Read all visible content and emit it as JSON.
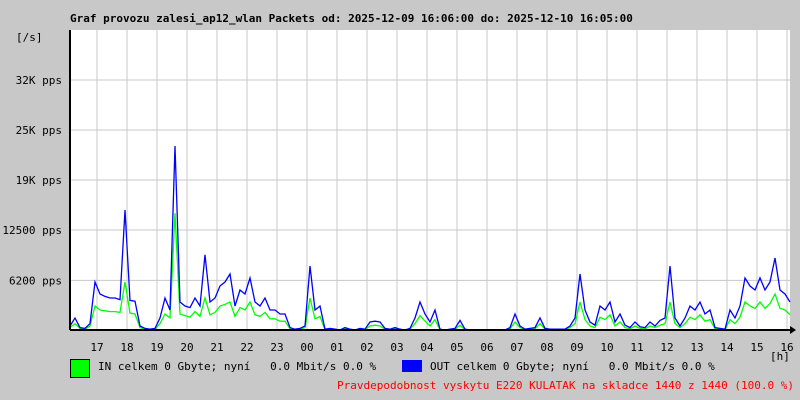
{
  "chart_data": {
    "type": "line",
    "title": "Graf provozu zalesi_ap12_wlan Packets od: 2025-12-09 16:06:00 do: 2025-12-10 16:05:00",
    "ylabel": "[/s]",
    "xlabel": "[h]",
    "ylim": [
      0,
      37500
    ],
    "xlim_hours": [
      0,
      24
    ],
    "grid": true,
    "y_ticks": [
      {
        "value": 6200,
        "label": "6200 pps"
      },
      {
        "value": 12500,
        "label": "12500 pps"
      },
      {
        "value": 18750,
        "label": "19K pps"
      },
      {
        "value": 25000,
        "label": "25K pps"
      },
      {
        "value": 31250,
        "label": "32K pps"
      }
    ],
    "x_tick_labels": [
      "17",
      "18",
      "19",
      "20",
      "21",
      "22",
      "23",
      "00",
      "01",
      "02",
      "03",
      "04",
      "05",
      "06",
      "07",
      "08",
      "09",
      "10",
      "11",
      "12",
      "13",
      "14",
      "15",
      "16"
    ],
    "x_first_tick_offset_hours": 0.9,
    "sample_interval_minutes": 10,
    "series": [
      {
        "name": "IN",
        "color": "#00ff00",
        "values": [
          300,
          800,
          200,
          100,
          500,
          3000,
          2500,
          2400,
          2300,
          2300,
          2200,
          6000,
          2100,
          2000,
          300,
          100,
          50,
          100,
          800,
          2000,
          1500,
          14600,
          2000,
          1800,
          1600,
          2300,
          1700,
          4000,
          1900,
          2200,
          3000,
          3200,
          3500,
          1700,
          2800,
          2500,
          3500,
          1900,
          1700,
          2200,
          1400,
          1400,
          1100,
          1100,
          150,
          50,
          100,
          300,
          4000,
          1400,
          1700,
          50,
          100,
          50,
          0,
          150,
          50,
          0,
          100,
          50,
          500,
          600,
          500,
          100,
          50,
          150,
          50,
          0,
          100,
          800,
          1800,
          1100,
          500,
          1300,
          50,
          0,
          50,
          100,
          600,
          50,
          0,
          0,
          0,
          0,
          0,
          0,
          0,
          0,
          150,
          1000,
          300,
          50,
          100,
          150,
          800,
          100,
          50,
          50,
          50,
          50,
          300,
          800,
          3500,
          1300,
          500,
          300,
          1600,
          1300,
          1900,
          500,
          1000,
          300,
          150,
          500,
          200,
          150,
          500,
          300,
          600,
          800,
          3500,
          800,
          300,
          800,
          1600,
          1300,
          1900,
          1100,
          1300,
          150,
          100,
          50,
          1300,
          800,
          1600,
          3500,
          3000,
          2700,
          3500,
          2700,
          3300,
          4500,
          2700,
          2500,
          1900
        ]
      },
      {
        "name": "OUT",
        "color": "#0000ff",
        "values": [
          500,
          1500,
          300,
          200,
          800,
          6000,
          4500,
          4200,
          4000,
          4000,
          3800,
          15000,
          3700,
          3600,
          500,
          200,
          100,
          200,
          1500,
          4000,
          2500,
          23000,
          3500,
          3000,
          2800,
          4000,
          3000,
          9400,
          3500,
          4000,
          5500,
          6000,
          7000,
          3000,
          5000,
          4500,
          6500,
          3500,
          3000,
          4000,
          2500,
          2500,
          2000,
          2000,
          300,
          100,
          200,
          500,
          8000,
          2500,
          3000,
          100,
          200,
          100,
          0,
          300,
          100,
          0,
          200,
          100,
          1000,
          1100,
          1000,
          200,
          100,
          300,
          100,
          0,
          200,
          1500,
          3500,
          2000,
          1000,
          2500,
          100,
          0,
          100,
          200,
          1200,
          100,
          0,
          0,
          0,
          0,
          0,
          0,
          0,
          0,
          300,
          2000,
          500,
          100,
          200,
          300,
          1500,
          200,
          100,
          100,
          100,
          100,
          500,
          1500,
          7000,
          2500,
          1000,
          600,
          3000,
          2500,
          3500,
          1000,
          2000,
          600,
          300,
          1000,
          400,
          300,
          1000,
          500,
          1200,
          1500,
          8000,
          1500,
          500,
          1500,
          3000,
          2500,
          3500,
          2000,
          2500,
          300,
          200,
          100,
          2500,
          1500,
          3000,
          6500,
          5500,
          5000,
          6500,
          5000,
          6000,
          9000,
          5000,
          4500,
          3500
        ]
      }
    ]
  },
  "legend": {
    "in_text": "IN celkem 0 Gbyte; nyní   0.0 Mbit/s 0.0 %",
    "out_text": "OUT celkem 0 Gbyte; nyní   0.0 Mbit/s 0.0 %",
    "probability_text": "Pravdepodobnost vyskytu E220 KULATAK na skladce 1440 z 1440 (100.0 %)"
  }
}
